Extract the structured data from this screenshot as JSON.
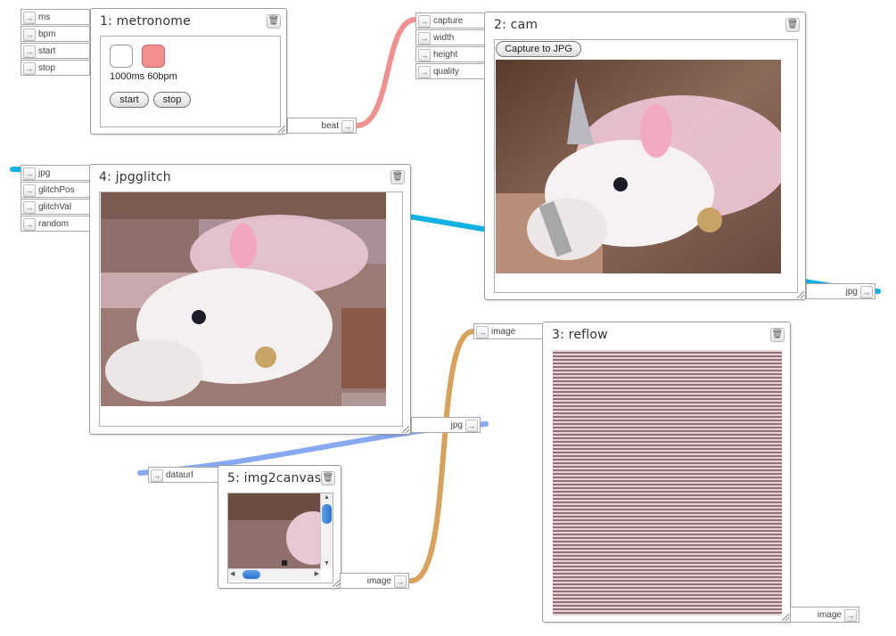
{
  "colors": {
    "wire_beat": "#f28f8f",
    "wire_jpg_cam": "#12b1e3",
    "wire_image_flow": "#d9a25c",
    "wire_dataurl": "#86a9f0",
    "metronome_off": "#ffffff",
    "metronome_on": "#f28f8f"
  },
  "nodes": {
    "metronome": {
      "title": "1: metronome",
      "inputs": [
        "ms",
        "bpm",
        "start",
        "stop"
      ],
      "output": "beat",
      "status": "1000ms 60bpm",
      "start_label": "start",
      "stop_label": "stop"
    },
    "cam": {
      "title": "2: cam",
      "inputs": [
        "capture",
        "width",
        "height",
        "quality"
      ],
      "output": "jpg",
      "capture_button": "Capture to JPG"
    },
    "reflow": {
      "title": "3: reflow",
      "inputs": [
        "image"
      ],
      "output": "image"
    },
    "jpgglitch": {
      "title": "4: jpgglitch",
      "inputs": [
        "jpg",
        "glitchPos",
        "glitchVal",
        "random"
      ],
      "output": "jpg"
    },
    "img2canvas": {
      "title": "5: img2canvas",
      "inputs": [
        "dataurl"
      ],
      "output": "image"
    }
  },
  "icons": {
    "port_arrow": "→",
    "trash": "🗑",
    "scroll_up": "▲",
    "scroll_down": "▼",
    "scroll_left": "◀",
    "scroll_right": "▶"
  }
}
